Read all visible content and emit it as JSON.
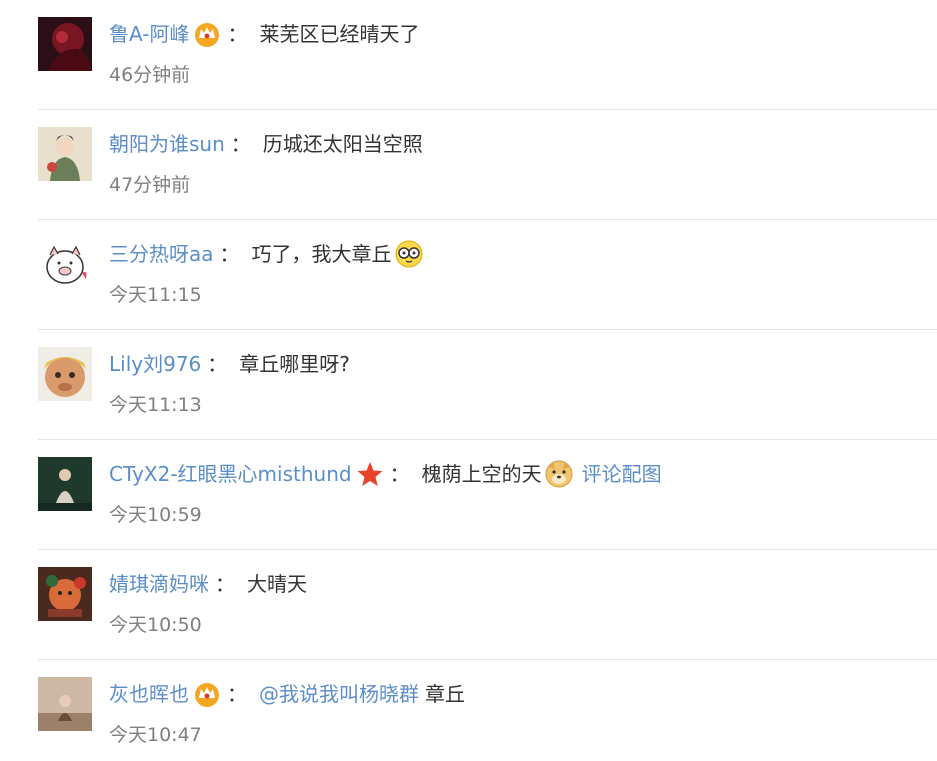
{
  "comments": [
    {
      "username": "鲁A-阿峰",
      "badge": "crown-icon",
      "colon": "：",
      "text": "莱芜区已经晴天了",
      "time": "46分钟前"
    },
    {
      "username": "朝阳为谁sun",
      "colon": "：",
      "text": "历城还太阳当空照",
      "time": "47分钟前"
    },
    {
      "username": "三分热呀aa",
      "colon": "：",
      "text": "巧了，我大章丘",
      "emoji": "glasses-face-icon",
      "time": "今天11:15"
    },
    {
      "username": "Lily刘976",
      "colon": "：",
      "text": "章丘哪里呀?",
      "time": "今天11:13"
    },
    {
      "username": "CTyX2-红眼黑心misthund",
      "badge": "star-icon",
      "colon": "：",
      "text": "槐荫上空的天",
      "emoji": "doge-icon",
      "link": "评论配图",
      "time": "今天10:59"
    },
    {
      "username": "婧琪滴妈咪",
      "colon": "：",
      "text": "大晴天",
      "time": "今天10:50"
    },
    {
      "username": "灰也晖也",
      "badge": "crown-icon",
      "colon": "：",
      "mention": "@我说我叫杨晓群",
      "text": "章丘",
      "time": "今天10:47"
    }
  ],
  "colors": {
    "link": "#5b8ec9",
    "text": "#333333",
    "time": "#808080",
    "divider": "#e6e6e6"
  }
}
